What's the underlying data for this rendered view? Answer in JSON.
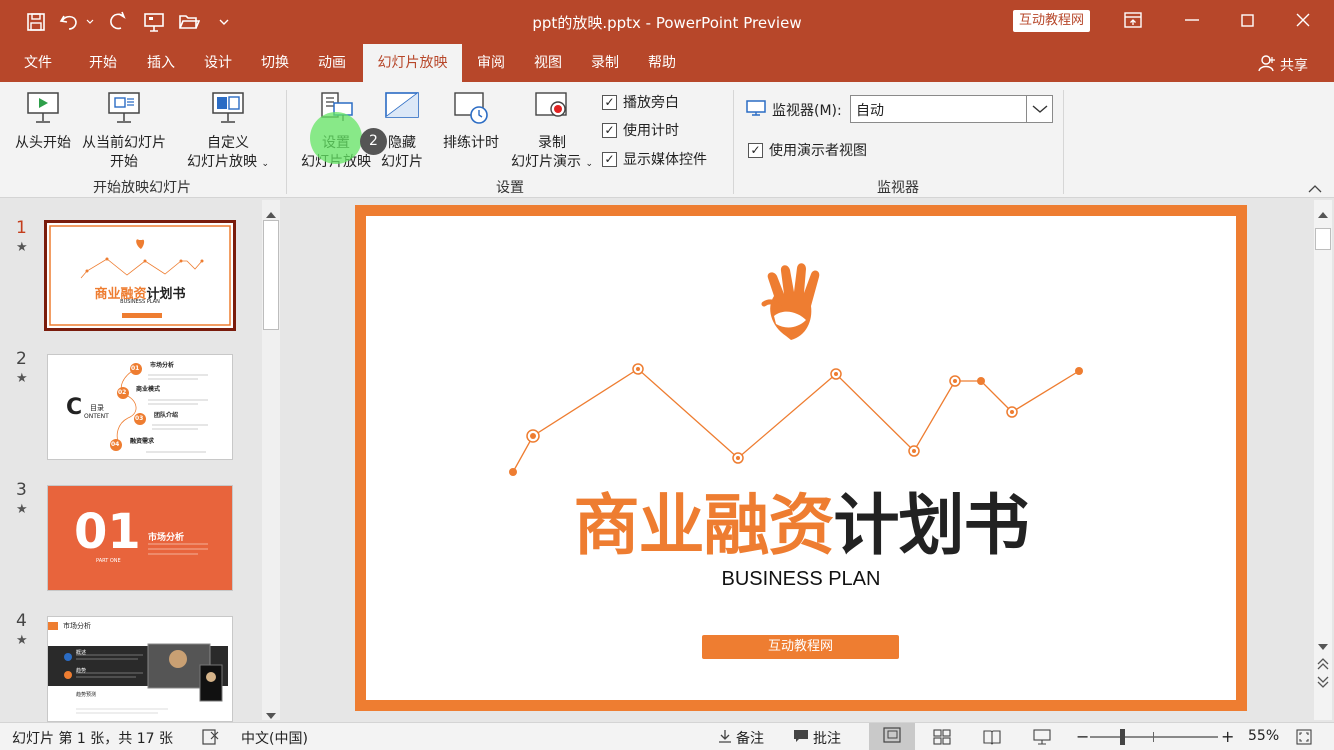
{
  "window": {
    "doc_title": "ppt的放映.pptx  -  PowerPoint Preview",
    "brand_badge": "互动教程网"
  },
  "tabs": [
    {
      "label": "文件"
    },
    {
      "label": "开始"
    },
    {
      "label": "插入"
    },
    {
      "label": "设计"
    },
    {
      "label": "切换"
    },
    {
      "label": "动画"
    },
    {
      "label": "幻灯片放映"
    },
    {
      "label": "审阅"
    },
    {
      "label": "视图"
    },
    {
      "label": "录制"
    },
    {
      "label": "帮助"
    }
  ],
  "share_label": "共享",
  "ribbon": {
    "start_group": {
      "from_start": "从头开始",
      "from_current_l1": "从当前幻灯片",
      "from_current_l2": "开始",
      "custom_l1": "自定义",
      "custom_l2": "幻灯片放映",
      "label": "开始放映幻灯片"
    },
    "setup_group": {
      "setup_l1": "设置",
      "setup_l2": "幻灯片放映",
      "hide_l1": "隐藏",
      "hide_l2": "幻灯片",
      "rehearse": "排练计时",
      "record_l1": "录制",
      "record_l2": "幻灯片演示",
      "cb_narration": "播放旁白",
      "cb_timings": "使用计时",
      "cb_media": "显示媒体控件",
      "label": "设置"
    },
    "monitor_group": {
      "monitor_label": "监视器(M):",
      "monitor_value": "自动",
      "cb_presenter": "使用演示者视图",
      "label": "监视器"
    },
    "step_badge": "2"
  },
  "thumbnails": [
    {
      "num": "1",
      "title_orange": "商业融资",
      "title_black": "计划书",
      "sub": "BUSINESS PLAN"
    },
    {
      "num": "2",
      "c_letter": "C",
      "c_word1": "目录",
      "c_word2": "ONTENT",
      "items": [
        {
          "n": "01",
          "t": "市场分析"
        },
        {
          "n": "02",
          "t": "商业模式"
        },
        {
          "n": "03",
          "t": "团队介绍"
        },
        {
          "n": "04",
          "t": "融资需求"
        }
      ]
    },
    {
      "num": "3",
      "big": "01",
      "label": "市场分析",
      "part": "PART ONE"
    },
    {
      "num": "4",
      "header": "市场分析",
      "label_a": "概述",
      "label_b": "趋势",
      "label_c": "趋势预测"
    }
  ],
  "slide": {
    "title_orange": "商业融资",
    "title_black": "计划书",
    "subtitle": "BUSINESS PLAN",
    "button": "互动教程网"
  },
  "status": {
    "slide_info": "幻灯片 第 1 张，共 17 张",
    "language": "中文(中国)",
    "notes": "备注",
    "comments": "批注",
    "zoom": "55%"
  },
  "colors": {
    "brand": "#b7472a",
    "accent": "#ee7d31",
    "selected_border": "#7a1c0c"
  }
}
